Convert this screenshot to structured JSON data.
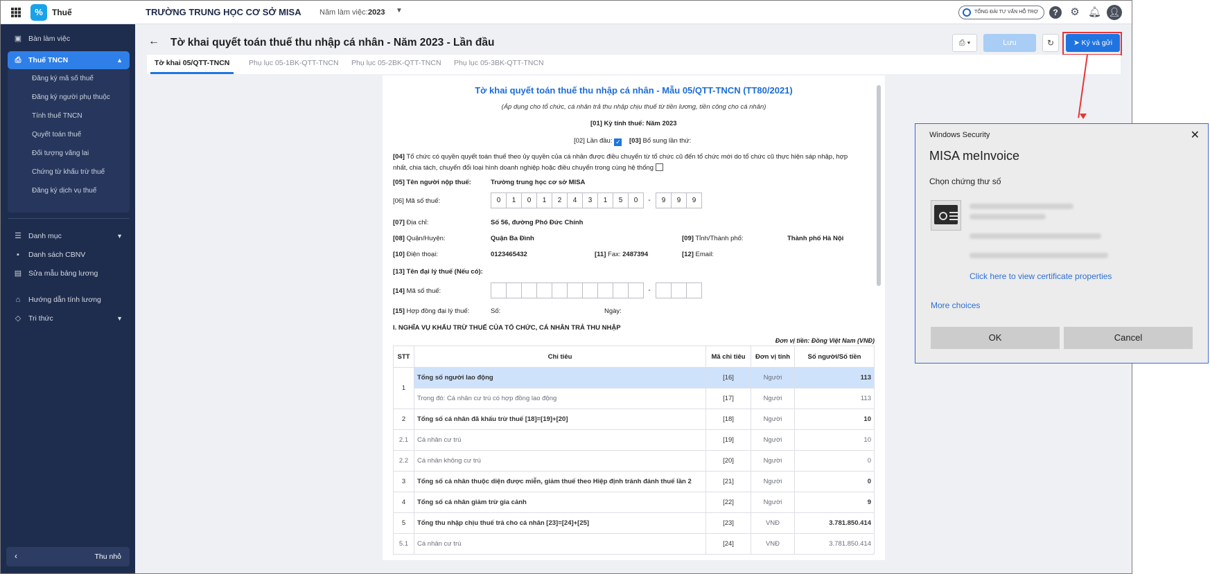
{
  "topbar": {
    "app_name": "Thuế",
    "logo_glyph": "%",
    "org_name": "TRƯỜNG TRUNG HỌC CƠ SỞ MISA",
    "year_label": "Năm làm việc:",
    "year_value": "2023",
    "hotline_label": "TỔNG ĐÀI TƯ VẤN HỖ TRỢ",
    "icons": [
      "grid-icon",
      "help-icon",
      "gear-icon",
      "bell-icon",
      "user-icon"
    ]
  },
  "sidebar": {
    "items": [
      {
        "label": "Bàn làm việc",
        "icon": "desk-icon"
      },
      {
        "label": "Thuế TNCN",
        "icon": "tax-icon",
        "active": true
      },
      {
        "label": "Danh mục",
        "icon": "list-icon"
      },
      {
        "label": "Danh sách CBNV",
        "icon": "people-icon"
      },
      {
        "label": "Sửa mẫu bảng lương",
        "icon": "edit-template-icon"
      },
      {
        "label": "Hướng dẫn tính lương",
        "icon": "guide-icon"
      },
      {
        "label": "Tri thức",
        "icon": "knowledge-icon"
      }
    ],
    "subitems": [
      "Đăng ký mã số thuế",
      "Đăng ký người phụ thuộc",
      "Tính thuế TNCN",
      "Quyết toán thuế",
      "Đối tượng vãng lai",
      "Chứng từ khấu trừ thuế",
      "Đăng ký dịch vụ thuế"
    ],
    "collapse_label": "Thu nhỏ"
  },
  "header": {
    "title": "Tờ khai quyết toán thuế thu nhập cá nhân - Năm 2023 - Lần đầu",
    "save_label": "Lưu",
    "sign_label": "Ký và gửi"
  },
  "tabs": [
    "Tờ khai 05/QTT-TNCN",
    "Phụ lục 05-1BK-QTT-TNCN",
    "Phụ lục 05-2BK-QTT-TNCN",
    "Phụ lục 05-3BK-QTT-TNCN"
  ],
  "document": {
    "title": "Tờ khai quyết toán thuế thu nhập cá nhân - Mẫu 05/QTT-TNCN (TT80/2021)",
    "subtitle": "(Áp dụng cho tổ chức, cá nhân trả thu nhập chịu thuế từ tiền lương, tiền công cho cá nhân)",
    "period": "[01] Kỳ tính thuế: Năm 2023",
    "first_time": "[02] Lần đầu:",
    "supplement_code": "[03]",
    "supplement": "Bổ sung lần thứ:",
    "item04_code": "[04]",
    "item04_line1": "Tổ chức có quyền quyết toán thuế theo ủy quyền của cá nhân được điều chuyển từ tổ chức cũ đến tổ chức mới do tổ chức cũ thực hiện sáp nhập, hợp",
    "item04_line2": "nhất, chia tách, chuyển đổi loại hình doanh nghiệp hoặc điều chuyển trong cùng hệ thống",
    "taxpayer_label": "[05] Tên người nộp thuế:",
    "taxpayer_value": "Trường trung học cơ sở MISA",
    "tax_code_label": "[06] Mã số thuế:",
    "tax_code_digits": [
      "0",
      "1",
      "0",
      "1",
      "2",
      "4",
      "3",
      "1",
      "5",
      "0"
    ],
    "tax_code_suffix": [
      "9",
      "9",
      "9"
    ],
    "dash": "-",
    "address_code": "[07]",
    "address_label": "Địa chỉ:",
    "address_value": "Số 56, đường Phó Đức Chính",
    "district_code": "[08]",
    "district_label": "Quận/Huyện:",
    "district_value": "Quận Ba Đình",
    "province_code": "[09]",
    "province_label": "Tỉnh/Thành phố:",
    "province_value": "Thành phố Hà Nội",
    "phone_code": "[10]",
    "phone_label": "Điện thoại:",
    "phone_value": "0123465432",
    "fax_code": "[11]",
    "fax_label": "Fax:",
    "fax_value": "2487394",
    "email_code": "[12]",
    "email_label": "Email:",
    "agent_label": "[13] Tên đại lý thuế (Nếu có):",
    "agent_tax_code": "[14]",
    "agent_tax_label": "Mã số thuế:",
    "contract_code": "[15]",
    "contract_label": "Hợp đồng đại lý thuế:",
    "contract_no": "Số:",
    "contract_date": "Ngày:",
    "section1": "I. NGHĨA VỤ KHẤU TRỪ THUẾ CỦA TỔ CHỨC, CÁ NHÂN TRẢ THU NHẬP",
    "currency_unit": "Đơn vị tiền: Đồng Việt Nam (VNĐ)",
    "table_headers": [
      "STT",
      "Chỉ tiêu",
      "Mã chỉ tiêu",
      "Đơn vị tính",
      "Số người/Số tiền"
    ],
    "rows": [
      {
        "stt": "1",
        "name": "Tổng số người lao động",
        "code": "[16]",
        "unit": "Người",
        "value": "113"
      },
      {
        "stt": "",
        "name": "Trong đó: Cá nhân cư trú có hợp đồng lao động",
        "code": "[17]",
        "unit": "Người",
        "value": "113"
      },
      {
        "stt": "2",
        "name": "Tổng số cá nhân đã khấu trừ thuế [18]=[19]+[20]",
        "code": "[18]",
        "unit": "Người",
        "value": "10"
      },
      {
        "stt": "2.1",
        "name": "Cá nhân cư trú",
        "code": "[19]",
        "unit": "Người",
        "value": "10"
      },
      {
        "stt": "2.2",
        "name": "Cá nhân không cư trú",
        "code": "[20]",
        "unit": "Người",
        "value": "0"
      },
      {
        "stt": "3",
        "name": "Tổng số cá nhân thuộc diện được miễn, giảm thuế theo Hiệp định tránh đánh thuế lần 2",
        "code": "[21]",
        "unit": "Người",
        "value": "0"
      },
      {
        "stt": "4",
        "name": "Tổng số cá nhân giảm trừ gia cảnh",
        "code": "[22]",
        "unit": "Người",
        "value": "9"
      },
      {
        "stt": "5",
        "name": "Tổng thu nhập chịu thuế trả cho cá nhân [23]=[24]+[25]",
        "code": "[23]",
        "unit": "VNĐ",
        "value": "3.781.850.414"
      },
      {
        "stt": "5.1",
        "name": "Cá nhân cư trú",
        "code": "[24]",
        "unit": "VNĐ",
        "value": "3.781.850.414"
      }
    ]
  },
  "dialog": {
    "caption": "Windows Security",
    "app": "MISA meInvoice",
    "prompt": "Chọn chứng thư số",
    "cert_link": "Click here to view certificate properties",
    "more_choices": "More choices",
    "ok_label": "OK",
    "cancel_label": "Cancel"
  },
  "colors": {
    "sidebar_bg": "#1e2c4d",
    "accent": "#1f74e0",
    "highlight_row": "#cfe2fb",
    "annotation_red": "#e53535"
  }
}
